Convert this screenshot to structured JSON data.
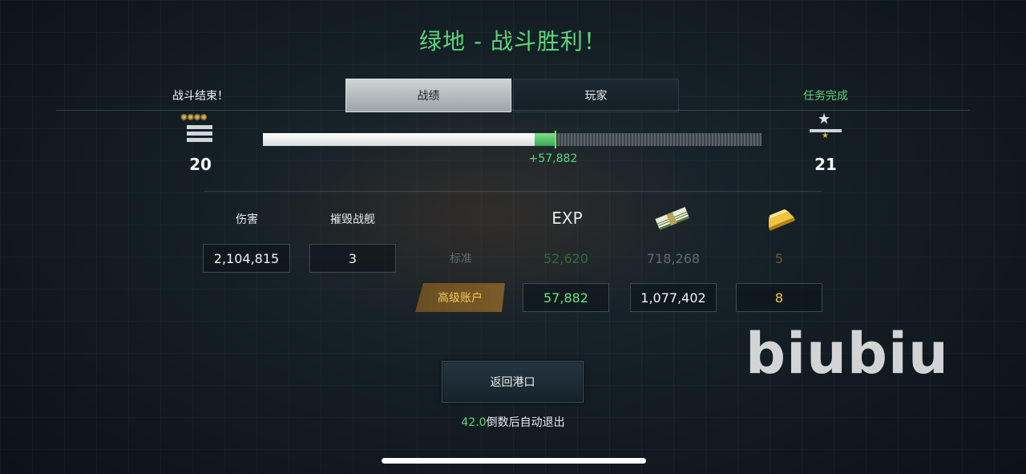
{
  "title": "绿地 - 战斗胜利！",
  "header": {
    "battle_end": "战斗结束！",
    "mission_done": "任务完成",
    "tabs": [
      {
        "label": "战绩",
        "active": true
      },
      {
        "label": "玩家",
        "active": false
      }
    ]
  },
  "progress": {
    "current_level": "20",
    "next_level": "21",
    "base_fraction": 0.545,
    "gain_fraction": 0.04,
    "gain_label": "+57,882",
    "rank_icon_left": "rank-insignia-icon",
    "rank_icon_right": "star-rank-icon"
  },
  "stats": {
    "damage_label": "伤害",
    "damage_value": "2,104,815",
    "kills_label": "摧毁战舰",
    "kills_value": "3"
  },
  "rewards": {
    "exp_header": "EXP",
    "credit_icon": "cash-stack-icon",
    "gold_icon": "gold-bar-icon",
    "standard": {
      "label": "标准",
      "exp": "52,620",
      "credits": "718,268",
      "gold": "5"
    },
    "premium": {
      "label": "高级账户",
      "exp": "57,882",
      "credits": "1,077,402",
      "gold": "8"
    }
  },
  "footer": {
    "return_button": "返回港口",
    "countdown_value": "42.0",
    "countdown_text": "倒数后自动退出"
  },
  "watermark": "biubiu",
  "colors": {
    "accent_green": "#5fd67a",
    "gold": "#f1c659",
    "premium_bg": "#6a4e22"
  }
}
